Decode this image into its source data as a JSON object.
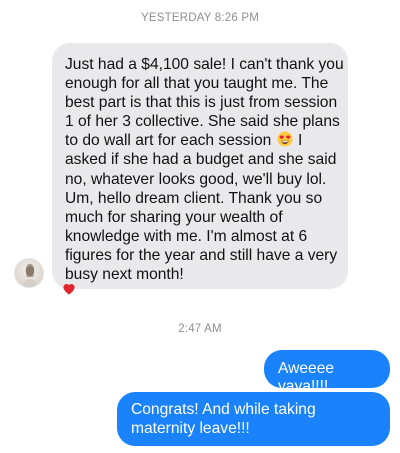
{
  "thread": {
    "timestamp_1": "YESTERDAY 8:26 PM",
    "timestamp_2": "2:47 AM"
  },
  "incoming_message": {
    "lines": [
      "Just had a $4,100 sale! I can't thank you",
      "enough for all that you taught me. The",
      "best part is that this is just from session",
      "1 of her 3 collective. She said she plans",
      "to do wall art for each session",
      "asked if she had a budget and she said",
      "no, whatever looks good, we'll buy lol.",
      "Um, hello dream client. Thank you so",
      "much for sharing your wealth of",
      "knowledge with me. I'm almost at 6",
      "figures for the year and still have a very",
      "busy next month!"
    ],
    "line5_emoji": "heart-eyes-emoji",
    "line5_after": " I",
    "reaction": "heart-reaction-icon",
    "reaction_color": "#e0262c",
    "bubble_color": "#e9e9eb"
  },
  "outgoing_messages": [
    "Aweeee yaya!!!!",
    "Congrats! And while taking maternity leave!!!"
  ],
  "colors": {
    "outgoing_bubble": "#1a82fb",
    "timestamp": "#8e8e93"
  }
}
